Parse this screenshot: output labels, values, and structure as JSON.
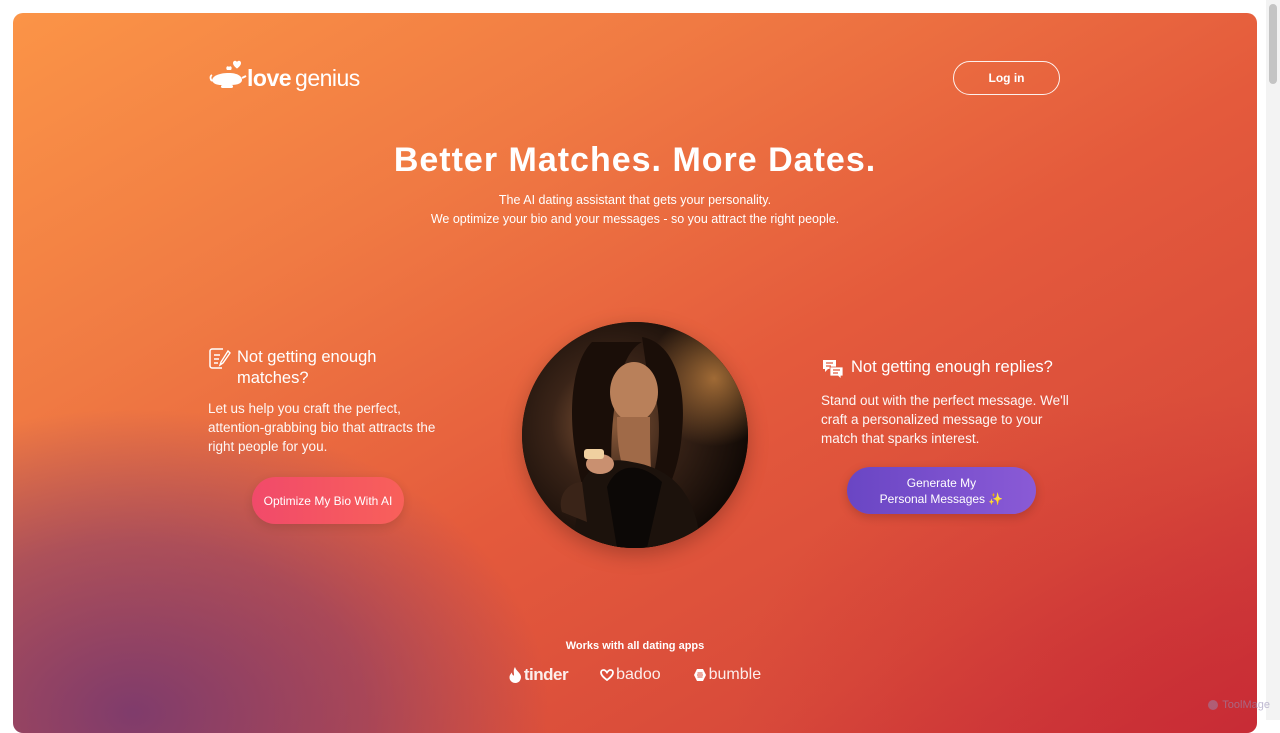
{
  "header": {
    "logo_word_1": "love",
    "logo_word_2": "genius",
    "login_label": "Log in"
  },
  "hero": {
    "title": "Better Matches. More Dates.",
    "subtitle_line_1": "The AI dating assistant that gets your personality.",
    "subtitle_line_2": "We optimize your bio and your messages - so you attract the right people."
  },
  "cards": {
    "bio": {
      "icon": "edit-document-icon",
      "title": "Not getting enough matches?",
      "text": "Let us help you craft the perfect, attention-grabbing bio that attracts the right people for you.",
      "button": "Optimize My Bio With AI"
    },
    "messages": {
      "icon": "chat-bubbles-icon",
      "title": "Not getting enough replies?",
      "text": "Stand out with the perfect message. We'll craft a personalized message to your match that sparks interest.",
      "button_line_1": "Generate My",
      "button_line_2": "Personal Messages ✨"
    }
  },
  "apps": {
    "heading": "Works with all dating apps",
    "items": [
      "tinder",
      "badoo",
      "bumble"
    ]
  },
  "watermark": "ToolMage",
  "colors": {
    "bg_top": "#fb9447",
    "bg_mid": "#e45a3c",
    "bg_bottom_left": "#7a3a6e",
    "bio_button": "#f14a6a",
    "messages_button": "#6a46c4"
  }
}
